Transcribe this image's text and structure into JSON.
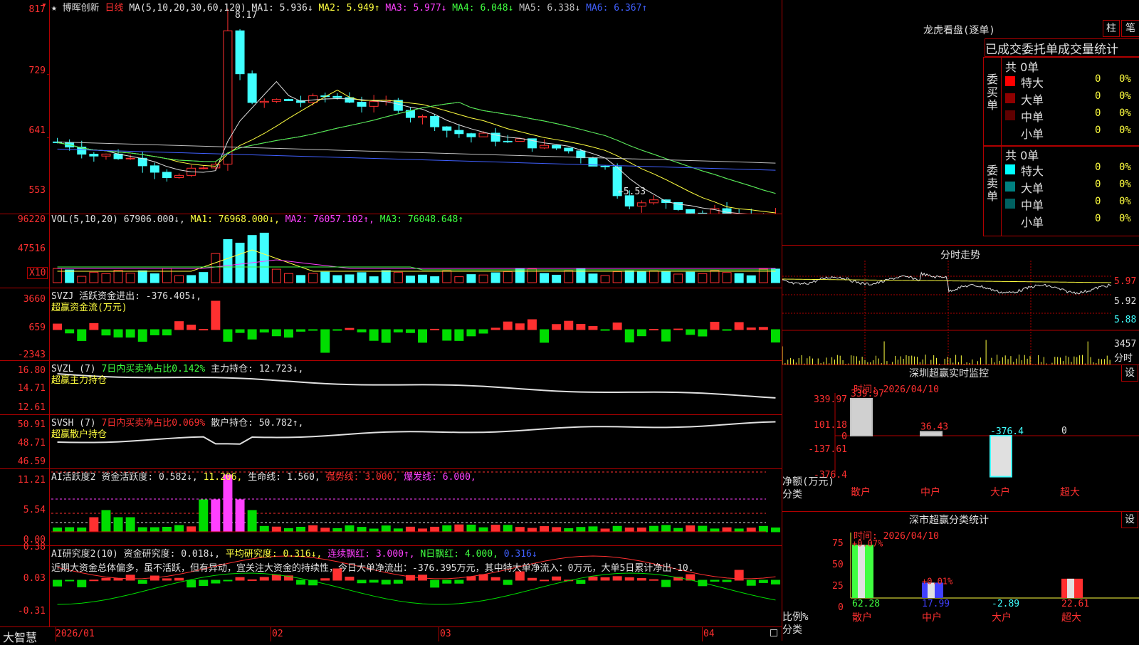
{
  "kline": {
    "title": "博晖创新",
    "period": "日线",
    "ma_legend": "MA(5,10,20,30,60,120)",
    "ma_items": [
      {
        "text": "MA1: 5.936↓",
        "color": "#e0e0e0"
      },
      {
        "text": "MA2: 5.949↑",
        "color": "#ffff40"
      },
      {
        "text": "MA3: 5.977↓",
        "color": "#ff40ff"
      },
      {
        "text": "MA4: 6.048↓",
        "color": "#40ff40"
      },
      {
        "text": "MA5: 6.338↓",
        "color": "#c0c0c0"
      },
      {
        "text": "MA6: 6.367↑",
        "color": "#4060ff"
      }
    ],
    "y_labels": [
      "817",
      "729",
      "641",
      "553"
    ],
    "high_marker": "8.17",
    "low_marker": "←5.53"
  },
  "vol": {
    "legend": "VOL(5,10,20)",
    "value": "67906.000↓,",
    "ma1": "MA1: 76968.000↓,",
    "ma2": "MA2: 76057.102↑,",
    "ma3": "MA3: 76048.648↑",
    "y_labels": [
      "96220",
      "47516"
    ],
    "unit": "X10"
  },
  "svzj": {
    "legend": "SVZJ  活跃资金进出: -376.405↓,",
    "subtitle": "超赢资金流(万元)",
    "y_labels": [
      "3660",
      "659",
      "-2343"
    ]
  },
  "svzl": {
    "legend_a": "SVZL (7)",
    "legend_b": "7日内买卖净占比0.142%",
    "legend_c": "主力持仓: 12.723↓,",
    "subtitle": "超赢主力持仓",
    "y_labels": [
      "16.80",
      "14.71",
      "12.61"
    ]
  },
  "svsh": {
    "legend_a": "SVSH (7)",
    "legend_b": "7日内买卖净占比0.069%",
    "legend_c": "散户持仓: 50.782↑,",
    "subtitle": "超赢散户持仓",
    "y_labels": [
      "50.91",
      "48.71",
      "46.59"
    ]
  },
  "ai_active": {
    "legend_a": "AI活跃度2",
    "legend_b": "资金活跃度: 0.582↓,",
    "legend_c": "11.206,",
    "legend_d": "生命线: 1.560,",
    "legend_e": "强势线: 3.000,",
    "legend_f": "爆发线: 6.000,",
    "y_labels": [
      "11.21",
      "5.54",
      "0.00"
    ]
  },
  "ai_research": {
    "legend_a": "AI研究度2(10)",
    "legend_b": "资金研究度: 0.018↓,",
    "legend_c": "平均研究度: 0.316↓,",
    "legend_d": "连续飘红: 3.000↑,",
    "legend_e": "N日飘红: 4.000,",
    "legend_f": "0.316↓",
    "comment": "近期大资金总体偏多，虽不活跃，但有异动，宜关注大资金的持续性，今日大单净流出：-376.395万元，其中特大单净流入：0万元，大单5日累计净出-10.",
    "y_labels": [
      "0.38",
      "0.03",
      "-0.31"
    ]
  },
  "bottom": {
    "brand": "大智慧",
    "dates": [
      "2026/01",
      "02",
      "03",
      "04"
    ]
  },
  "lhkp": {
    "title": "龙虎看盘(逐单)",
    "btn_col": "柱",
    "btn_pen": "笔",
    "tabs": [
      "已成交",
      "委托单",
      "成交量统计"
    ],
    "buy_label": "委买单",
    "sell_label": "委卖单",
    "buy_total": "共 0单",
    "sell_total": "共 0单",
    "buy_rows": [
      {
        "label": "特大",
        "num": "0",
        "pct": "0%",
        "color": "#ff0000"
      },
      {
        "label": "大单",
        "num": "0",
        "pct": "0%",
        "color": "#900000"
      },
      {
        "label": "中单",
        "num": "0",
        "pct": "0%",
        "color": "#600000"
      },
      {
        "label": "小单",
        "num": "0",
        "pct": "0%",
        "color": "#000000"
      }
    ],
    "sell_rows": [
      {
        "label": "特大",
        "num": "0",
        "pct": "0%",
        "color": "#00ffff"
      },
      {
        "label": "大单",
        "num": "0",
        "pct": "0%",
        "color": "#008080"
      },
      {
        "label": "中单",
        "num": "0",
        "pct": "0%",
        "color": "#006060"
      },
      {
        "label": "小单",
        "num": "0",
        "pct": "0%",
        "color": "#000000"
      }
    ]
  },
  "intraday": {
    "title": "分时走势",
    "price_labels": [
      "5.97",
      "5.92",
      "5.88"
    ],
    "vol_label": "3457",
    "vol_unit": "分时"
  },
  "sz_monitor": {
    "title": "深圳超赢实时监控",
    "settings": "设",
    "time": "时间: 2026/04/10",
    "y_labels": [
      "339.97",
      "101.18",
      "0",
      "-137.61",
      "-376.4"
    ],
    "ylabel": "净额(万元)",
    "xlabel": "分类",
    "bars": [
      {
        "cat": "散户",
        "value": 339.97,
        "label": "339.97"
      },
      {
        "cat": "中户",
        "value": 36.43,
        "label": "36.43"
      },
      {
        "cat": "大户",
        "value": -376.4,
        "label": "-376.4"
      },
      {
        "cat": "超大",
        "value": 0,
        "label": "0"
      }
    ]
  },
  "sz_class": {
    "title": "深市超赢分类统计",
    "settings": "设",
    "time": "时间: 2026/04/10",
    "y_labels": [
      "75",
      "50",
      "25",
      "0"
    ],
    "ylabel": "比例%",
    "xlabel": "分类",
    "bars": [
      {
        "cat": "散户",
        "value": 62.28,
        "label": "62.28",
        "change": "+0.07%"
      },
      {
        "cat": "中户",
        "value": 17.99,
        "label": "17.99",
        "change": "+0.01%"
      },
      {
        "cat": "大户",
        "value": -2.89,
        "label": "-2.89",
        "change": ""
      },
      {
        "cat": "超大",
        "value": 22.61,
        "label": "22.61",
        "change": ""
      }
    ]
  },
  "colors": {
    "up": "#ff3030",
    "down": "#40ffff",
    "frame": "#b00000",
    "bg": "#000000"
  }
}
